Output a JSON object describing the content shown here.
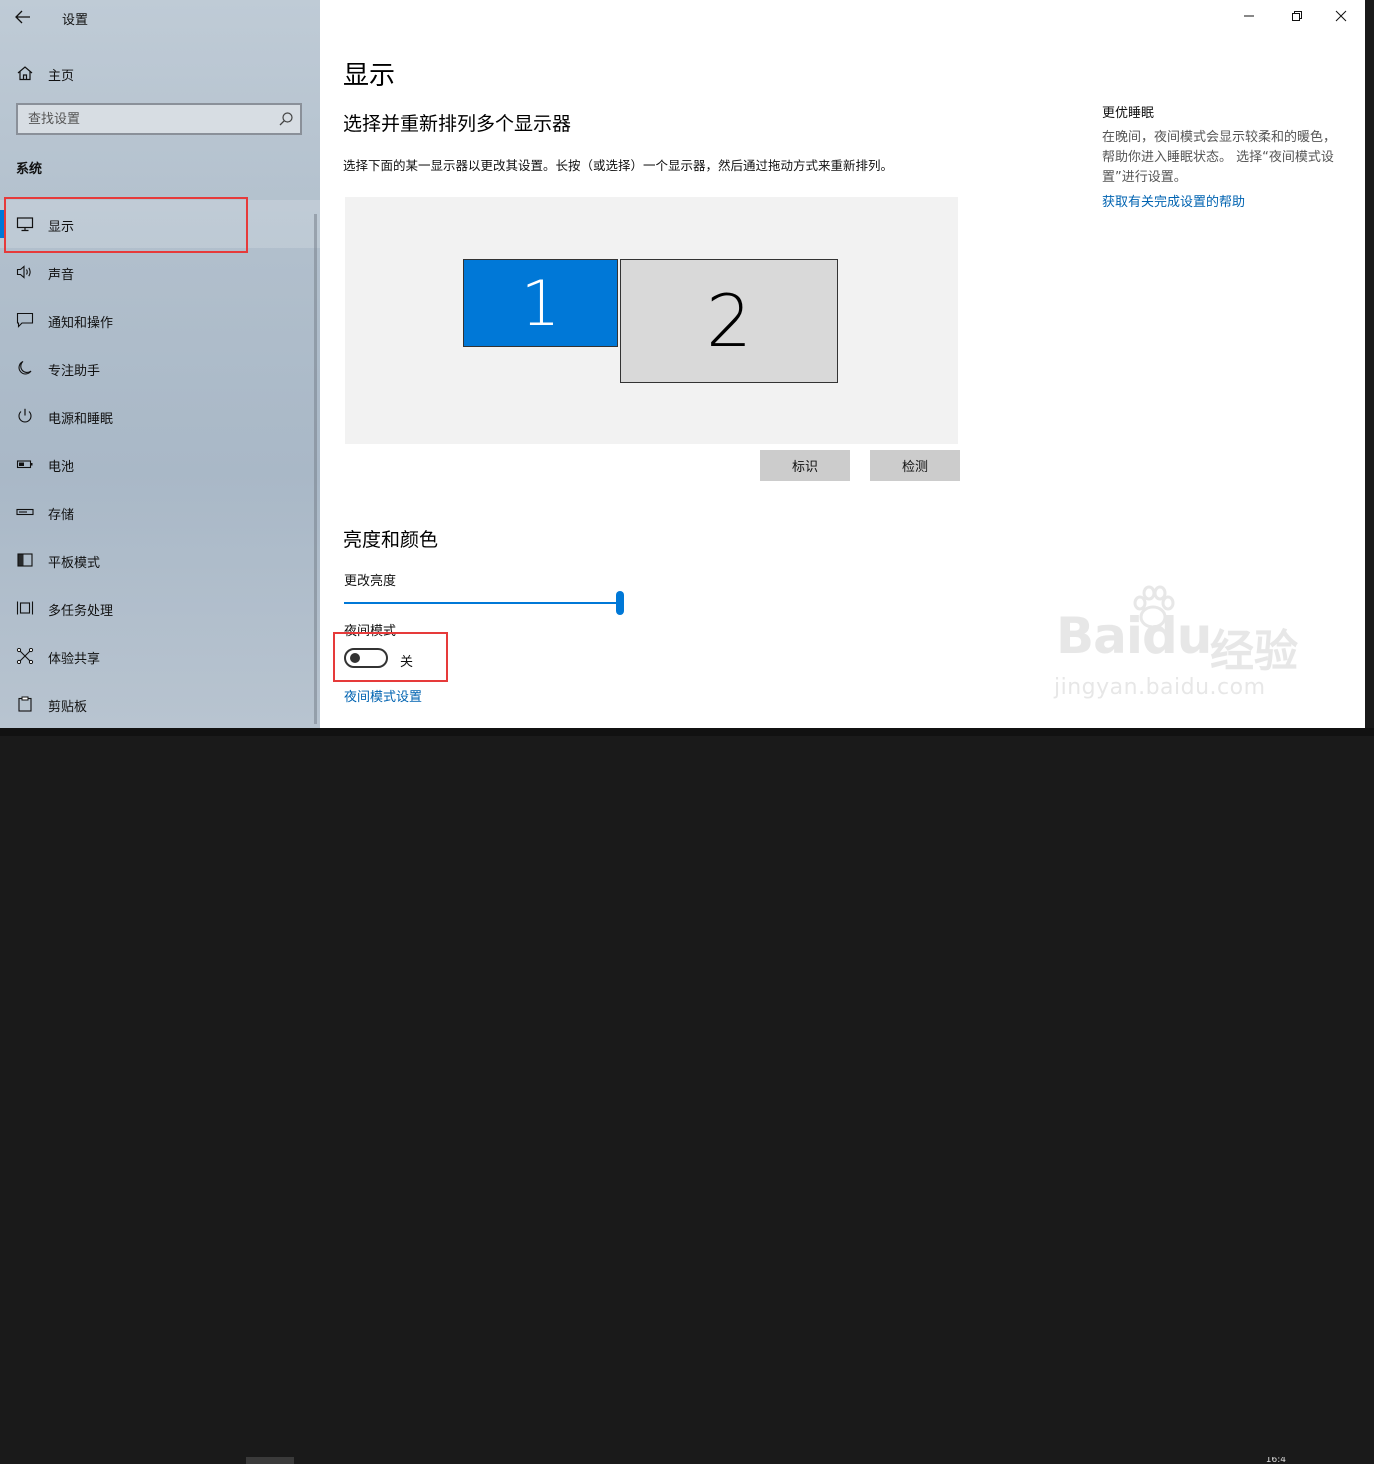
{
  "window": {
    "title": "设置",
    "controls": {
      "minimize": "minimize",
      "maximize": "maximize",
      "close": "close"
    }
  },
  "sidebar": {
    "home_label": "主页",
    "search": {
      "placeholder": "查找设置"
    },
    "section_label": "系统",
    "items": [
      {
        "label": "显示",
        "icon": "monitor-icon",
        "selected": true
      },
      {
        "label": "声音",
        "icon": "speaker-icon"
      },
      {
        "label": "通知和操作",
        "icon": "message-icon"
      },
      {
        "label": "专注助手",
        "icon": "moon-icon"
      },
      {
        "label": "电源和睡眠",
        "icon": "power-icon"
      },
      {
        "label": "电池",
        "icon": "battery-icon"
      },
      {
        "label": "存储",
        "icon": "storage-icon"
      },
      {
        "label": "平板模式",
        "icon": "tablet-icon"
      },
      {
        "label": "多任务处理",
        "icon": "multitask-icon"
      },
      {
        "label": "体验共享",
        "icon": "share-icon"
      },
      {
        "label": "剪贴板",
        "icon": "clipboard-icon"
      }
    ]
  },
  "main": {
    "title": "显示",
    "arrange": {
      "heading": "选择并重新排列多个显示器",
      "description": "选择下面的某一显示器以更改其设置。长按（或选择）一个显示器，然后通过拖动方式来重新排列。",
      "monitors": [
        {
          "label": "1",
          "selected": true
        },
        {
          "label": "2",
          "selected": false
        }
      ],
      "identify_label": "标识",
      "detect_label": "检测"
    },
    "brightness": {
      "heading": "亮度和颜色",
      "label": "更改亮度",
      "value_percent": 100
    },
    "night_light": {
      "label": "夜间模式",
      "state_label": "关",
      "on": false,
      "settings_link": "夜间模式设置"
    }
  },
  "side_panel": {
    "heading": "更优睡眠",
    "text": "在晚间，夜间模式会显示较柔和的暖色，帮助你进入睡眠状态。 选择“夜间模式设置”进行设置。",
    "link": "获取有关完成设置的帮助"
  },
  "watermark": {
    "logo": "Baidu",
    "cn": "经验",
    "url": "jingyan.baidu.com"
  },
  "taskbar": {
    "clock_fragment": "16:4"
  },
  "colors": {
    "accent": "#0078d7",
    "link": "#0063b1",
    "highlight_box": "#e63a3a"
  }
}
